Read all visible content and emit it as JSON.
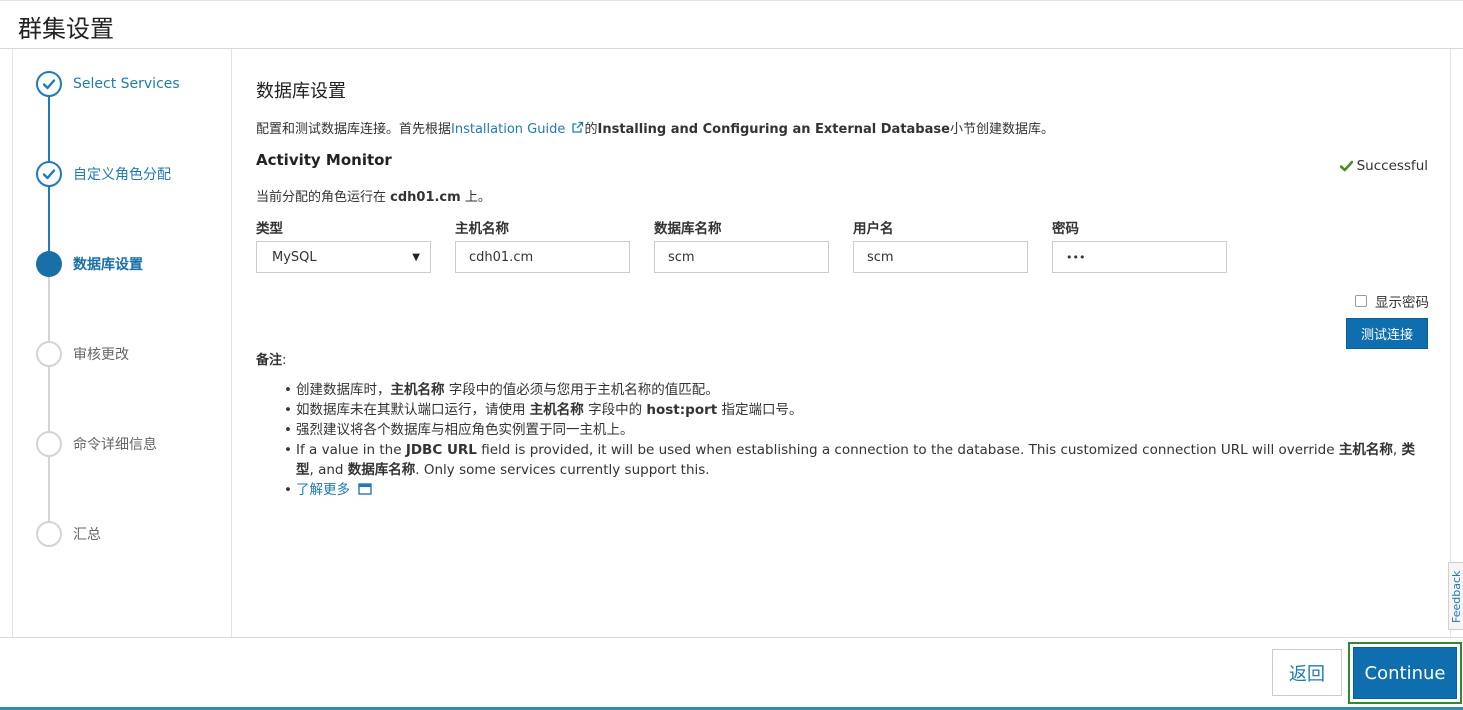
{
  "page": {
    "title": "群集设置"
  },
  "steps": [
    {
      "label": "Select Services",
      "state": "done"
    },
    {
      "label": "自定义角色分配",
      "state": "done"
    },
    {
      "label": "数据库设置",
      "state": "active"
    },
    {
      "label": "审核更改",
      "state": "todo"
    },
    {
      "label": "命令详细信息",
      "state": "todo"
    },
    {
      "label": "汇总",
      "state": "todo"
    }
  ],
  "main": {
    "section_title": "数据库设置",
    "desc_prefix": "配置和测试数据库连接。首先根据",
    "desc_link": "Installation Guide",
    "desc_middle": "的",
    "desc_bold": "Installing and Configuring an External Database",
    "desc_suffix": "小节创建数据库。",
    "subsection_title": "Activity Monitor",
    "status_text": "Successful",
    "host_prefix": "当前分配的角色运行在 ",
    "host_name": "cdh01.cm",
    "host_suffix": " 上。",
    "fields": {
      "type_label": "类型",
      "type_value": "MySQL",
      "hostname_label": "主机名称",
      "hostname_value": "cdh01.cm",
      "dbname_label": "数据库名称",
      "dbname_value": "scm",
      "username_label": "用户名",
      "username_value": "scm",
      "password_label": "密码",
      "password_value": "•••"
    },
    "show_password_label": "显示密码",
    "test_connection_label": "测试连接",
    "notes_title": "备注",
    "notes_colon": ":",
    "notes": {
      "n1_a": "创建数据库时，",
      "n1_b": "主机名称",
      "n1_c": " 字段中的值必须与您用于主机名称的值匹配。",
      "n2_a": "如数据库未在其默认端口运行，请使用 ",
      "n2_b": "主机名称",
      "n2_c": " 字段中的 ",
      "n2_d": "host:port",
      "n2_e": " 指定端口号。",
      "n3": "强烈建议将各个数据库与相应角色实例置于同一主机上。",
      "n4_a": "If a value in the ",
      "n4_b": "JDBC URL",
      "n4_c": " field is provided, it will be used when establishing a connection to the database. This customized connection URL will override ",
      "n4_d": "主机名称",
      "n4_e": ", ",
      "n4_f": "类型",
      "n4_g": ", and ",
      "n4_h": "数据库名称",
      "n4_i": ". Only some services currently support this.",
      "learn_more": "了解更多"
    }
  },
  "footer": {
    "back_label": "返回",
    "continue_label": "Continue"
  },
  "feedback_label": "Feedback",
  "colors": {
    "accent": "#0f6fae",
    "link": "#1f7ab5",
    "success": "#4a8c2a",
    "highlight_border": "#2f8a2f"
  }
}
